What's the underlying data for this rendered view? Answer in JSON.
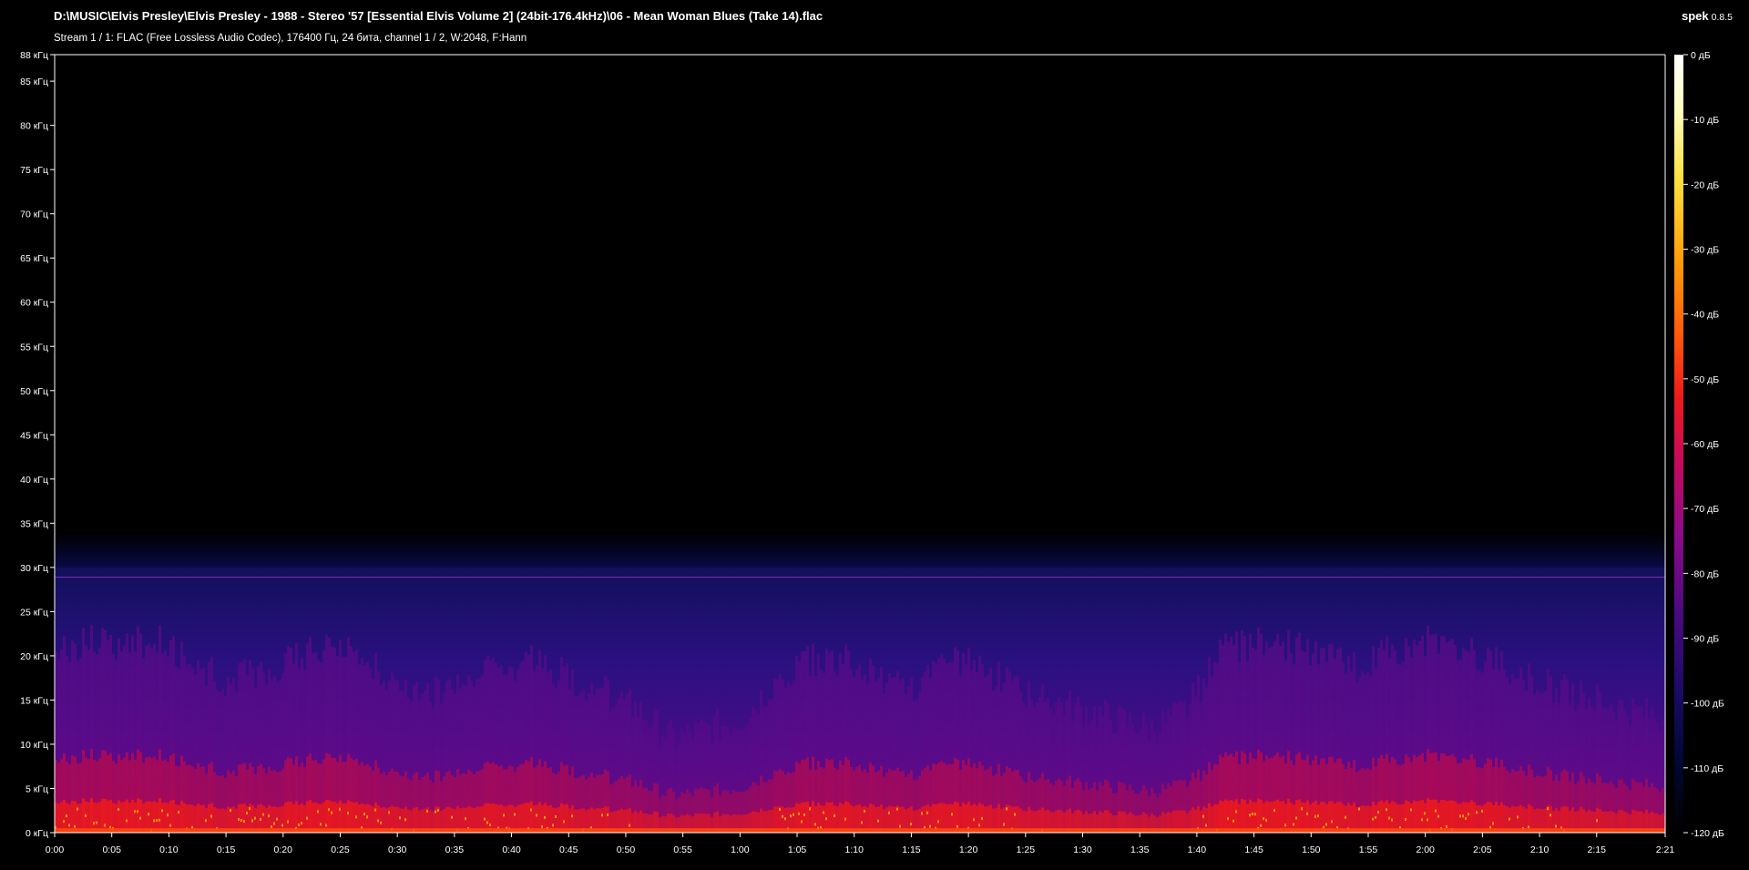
{
  "window": {
    "file_title": "D:\\MUSIC\\Elvis Presley\\Elvis Presley - 1988 - Stereo '57 [Essential Elvis Volume 2] (24bit-176.4kHz)\\06 - Mean Woman Blues (Take 14).flac",
    "stream_info": "Stream 1 / 1: FLAC (Free Lossless Audio Codec), 176400 Гц, 24 бита, channel 1 / 2, W:2048, F:Hann",
    "app_name": "spek",
    "app_version": "0.8.5"
  },
  "colors": {
    "background": "#000000",
    "axis": "#ffffff",
    "palette": [
      "#000000",
      "#000833",
      "#1a0a66",
      "#4a0a80",
      "#8a0a8a",
      "#c80a5a",
      "#ee1a1a",
      "#ff5a0a",
      "#ffa00a",
      "#ffe040",
      "#ffffc0",
      "#ffffff"
    ]
  },
  "chart_data": {
    "type": "heatmap",
    "title": "",
    "xlabel": "",
    "ylabel": "",
    "x_unit": "time (m:ss)",
    "y_unit": "кГц",
    "xlim": [
      0,
      141
    ],
    "ylim": [
      0,
      88
    ],
    "x_ticks": [
      "0:00",
      "0:05",
      "0:10",
      "0:15",
      "0:20",
      "0:25",
      "0:30",
      "0:35",
      "0:40",
      "0:45",
      "0:50",
      "0:55",
      "1:00",
      "1:05",
      "1:10",
      "1:15",
      "1:20",
      "1:25",
      "1:30",
      "1:35",
      "1:40",
      "1:45",
      "1:50",
      "1:55",
      "2:00",
      "2:05",
      "2:10",
      "2:15",
      "2:21"
    ],
    "x_tick_seconds": [
      0,
      5,
      10,
      15,
      20,
      25,
      30,
      35,
      40,
      45,
      50,
      55,
      60,
      65,
      70,
      75,
      80,
      85,
      90,
      95,
      100,
      105,
      110,
      115,
      120,
      125,
      130,
      135,
      141
    ],
    "y_ticks": [
      "0 кГц",
      "5 кГц",
      "10 кГц",
      "15 кГц",
      "20 кГц",
      "25 кГц",
      "30 кГц",
      "35 кГц",
      "40 кГц",
      "45 кГц",
      "50 кГц",
      "55 кГц",
      "60 кГц",
      "65 кГц",
      "70 кГц",
      "75 кГц",
      "80 кГц",
      "85 кГц",
      "88 кГц"
    ],
    "y_tick_khz": [
      0,
      5,
      10,
      15,
      20,
      25,
      30,
      35,
      40,
      45,
      50,
      55,
      60,
      65,
      70,
      75,
      80,
      85,
      88
    ],
    "colorbar_ticks": [
      "0 дБ",
      "-10 дБ",
      "-20 дБ",
      "-30 дБ",
      "-40 дБ",
      "-50 дБ",
      "-60 дБ",
      "-70 дБ",
      "-80 дБ",
      "-90 дБ",
      "-100 дБ",
      "-110 дБ",
      "-120 дБ"
    ],
    "colorbar_db": [
      0,
      -10,
      -20,
      -30,
      -40,
      -50,
      -60,
      -70,
      -80,
      -90,
      -100,
      -110,
      -120
    ],
    "spectral_cutoff_khz": 30,
    "noise_line_khz": 28.9,
    "energy_envelope": {
      "time_s": [
        0,
        3,
        6,
        9,
        12,
        15,
        18,
        21,
        24,
        27,
        30,
        33,
        36,
        39,
        42,
        45,
        48,
        51,
        54,
        57,
        60,
        63,
        66,
        69,
        72,
        75,
        78,
        81,
        84,
        87,
        90,
        93,
        96,
        99,
        102,
        105,
        108,
        111,
        114,
        117,
        120,
        123,
        126,
        129,
        132,
        135,
        138,
        141
      ],
      "level": [
        0.75,
        0.8,
        0.78,
        0.82,
        0.7,
        0.6,
        0.65,
        0.72,
        0.8,
        0.7,
        0.6,
        0.55,
        0.62,
        0.68,
        0.7,
        0.62,
        0.55,
        0.45,
        0.3,
        0.35,
        0.4,
        0.6,
        0.7,
        0.72,
        0.6,
        0.55,
        0.7,
        0.68,
        0.55,
        0.5,
        0.45,
        0.4,
        0.35,
        0.45,
        0.75,
        0.8,
        0.78,
        0.72,
        0.68,
        0.75,
        0.8,
        0.75,
        0.7,
        0.62,
        0.55,
        0.5,
        0.45,
        0.4
      ]
    }
  }
}
